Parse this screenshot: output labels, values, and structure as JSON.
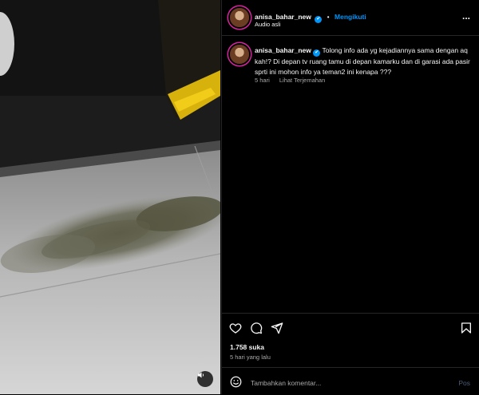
{
  "post": {
    "username": "anisa_bahar_new",
    "verified_mark": "✔",
    "follow_separator": "•",
    "follow_label": "Mengikuti",
    "audio_label": "Audio asli",
    "more_label": "...",
    "caption": "Tolong info ada yg kejadiannya sama dengan aq kah!? Di depan tv ruang tamu di depan kamarku dan di garasi ada pasir sprti ini mohon info ya teman2 ini kenapa ???",
    "caption_age": "5 hari",
    "translate_label": "Lihat Terjemahan",
    "likes": "1.758 suka",
    "posted_time": "5 hari yang lalu",
    "comment_placeholder": "Tambahkan komentar...",
    "post_button": "Pos"
  },
  "icons": {
    "like": "heart-icon",
    "comment": "comment-icon",
    "share": "send-icon",
    "save": "bookmark-icon",
    "emoji": "emoji-icon",
    "audio": "speaker-icon",
    "more": "more-icon"
  },
  "colors": {
    "background": "#000000",
    "accent": "#0095f6",
    "muted_text": "#a8a8a8",
    "divider": "#262626"
  }
}
